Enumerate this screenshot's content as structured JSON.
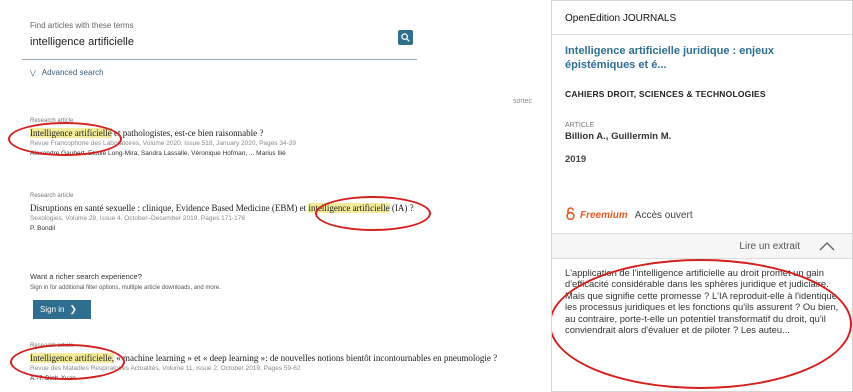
{
  "search": {
    "label": "Find articles with these terms",
    "value": "intelligence artificielle",
    "advanced": "Advanced search",
    "sort_label": "sortec"
  },
  "results": [
    {
      "type": "Research article",
      "title_highlight": "Intelligence artificielle",
      "title_rest": " et pathologistes, est-ce bien raisonnable ?",
      "journal": "Revue Francophone des Laboratoires, Volume 2020, Issue 518, January 2020, Pages 34-39",
      "authors": "Alexandre Gaubert, Elodie Long-Mira, Sandra Lassalle, Véronique Hofman, ... Marius Ilié"
    },
    {
      "type": "Research article",
      "title_before": "Disruptions en santé sexuelle : clinique, Evidence Based Medicine (EBM) et ",
      "title_highlight": "intelligence artificielle",
      "title_after": " (IA) ?",
      "journal": "Sexologies, Volume 28, Issue 4, October–December 2019, Pages 171-176",
      "authors": "P. Bondil"
    },
    {
      "type": "Research article",
      "title_highlight": "Intelligence artificielle,",
      "title_rest": " « machine learning » et « deep learning »: de nouvelles notions bientôt incontournables en pneumologie ?",
      "journal": "Revue des Maladies Respiratoires Actualités, Volume 11, Issue 2, October 2019, Pages 59-62",
      "authors": "A.-T. Dinh-Xuan"
    }
  ],
  "cta": {
    "title": "Want a richer search experience?",
    "text": "Sign in for additional filter options, multiple article downloads, and more.",
    "signin": "Sign in",
    "arrow": "❯"
  },
  "panel": {
    "brand": "OpenEdition JOURNALS",
    "title": "Intelligence artificielle juridique : enjeux épistémiques et é...",
    "journal": "CAHIERS DROIT, SCIENCES & TECHNOLOGIES",
    "type": "ARTICLE",
    "authors": "Billion A., Guillermin M.",
    "year": "2019",
    "freemium": "Freemium",
    "open_access": "Accès ouvert",
    "excerpt_label": "Lire un extrait",
    "abstract": "L'application de l'intelligence artificielle au droit promet un gain d'efficacité considérable dans les sphères juridique et judiciaire. Mais que signifie cette promesse ? L'IA reproduit-elle à l'identique les processus juridiques et les fonctions qu'ils assurent ? Ou bien, au contraire, porte-t-elle un potentiel transformatif du droit, qu'il conviendrait alors d'évaluer et de piloter ? Les auteu..."
  },
  "colors": {
    "highlight": "#f4ec9a",
    "annotation_ring": "#d3201e",
    "link_blue": "#2e6f92",
    "freemium_orange": "#e85b21",
    "button_blue": "#2e6e8e"
  }
}
